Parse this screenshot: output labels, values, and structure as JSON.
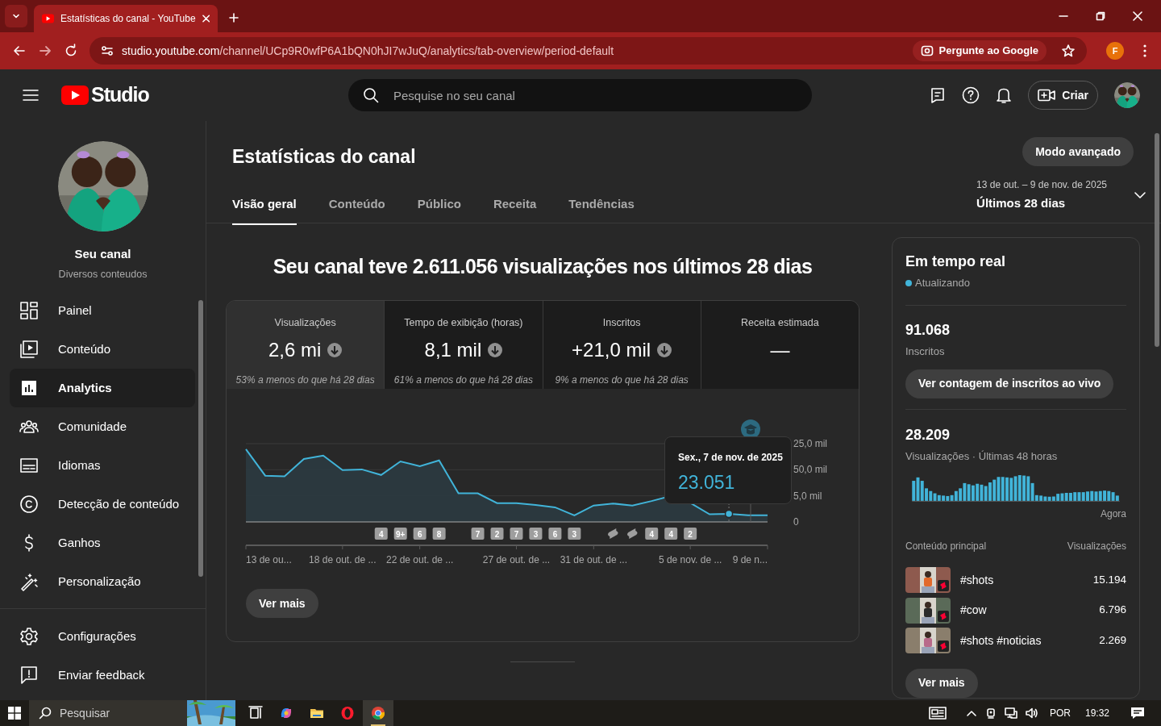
{
  "browser": {
    "tab_title": "Estatísticas do canal - YouTube",
    "url_host": "studio.youtube.com",
    "url_path": "/channel/UCp9R0wfP6A1bQN0hJI7wJuQ/analytics/tab-overview/period-default",
    "ask_google": "Pergunte ao Google",
    "profile_initial": "F"
  },
  "header": {
    "logo_text": "Studio",
    "search_placeholder": "Pesquise no seu canal",
    "create_label": "Criar"
  },
  "sidebar": {
    "channel_name": "Seu canal",
    "channel_description": "Diversos conteudos",
    "items": [
      {
        "kind": "dashboard",
        "label": "Painel",
        "selected": false
      },
      {
        "kind": "content",
        "label": "Conteúdo",
        "selected": false
      },
      {
        "kind": "analytics",
        "label": "Analytics",
        "selected": true
      },
      {
        "kind": "community",
        "label": "Comunidade",
        "selected": false
      },
      {
        "kind": "languages",
        "label": "Idiomas",
        "selected": false
      },
      {
        "kind": "copyright",
        "label": "Detecção de conteúdo",
        "selected": false
      },
      {
        "kind": "earnings",
        "label": "Ganhos",
        "selected": false
      },
      {
        "kind": "customization",
        "label": "Personalização",
        "selected": false
      }
    ],
    "footer_items": [
      {
        "kind": "settings",
        "label": "Configurações"
      },
      {
        "kind": "feedback",
        "label": "Enviar feedback"
      }
    ]
  },
  "page": {
    "title": "Estatísticas do canal",
    "advanced_button": "Modo avançado",
    "tabs": [
      {
        "label": "Visão geral",
        "selected": true
      },
      {
        "label": "Conteúdo",
        "selected": false
      },
      {
        "label": "Público",
        "selected": false
      },
      {
        "label": "Receita",
        "selected": false
      },
      {
        "label": "Tendências",
        "selected": false
      }
    ],
    "period": {
      "range": "13 de out. – 9 de nov. de 2025",
      "label": "Últimos 28 dias"
    }
  },
  "headline": "Seu canal teve 2.611.056 visualizações nos últimos 28 dias",
  "metrics": [
    {
      "label": "Visualizações",
      "value": "2,6 mi",
      "declined": true,
      "comparison": "53% a menos do que há 28 dias",
      "selected": true
    },
    {
      "label": "Tempo de exibição (horas)",
      "value": "8,1 mil",
      "declined": true,
      "comparison": "61% a menos do que há 28 dias",
      "selected": false
    },
    {
      "label": "Inscritos",
      "value": "+21,0 mil",
      "declined": true,
      "comparison": "9% a menos do que há 28 dias",
      "selected": false
    },
    {
      "label": "Receita estimada",
      "value": "—",
      "declined": false,
      "selected": false
    }
  ],
  "chart": {
    "y_labels": [
      "25,0 mil",
      "50,0 mil",
      "5,0 mil",
      "0"
    ],
    "x_labels": [
      "13 de ou...",
      "18 de out. de ...",
      "22 de out. de ...",
      "27 de out. de ...",
      "31 de out. de ...",
      "5 de nov. de ...",
      "9 de n..."
    ],
    "markers": [
      {
        "kind": "count",
        "label": "4"
      },
      {
        "kind": "count",
        "label": "9+"
      },
      {
        "kind": "count",
        "label": "6"
      },
      {
        "kind": "count",
        "label": "8"
      },
      {
        "kind": "count",
        "label": "7"
      },
      {
        "kind": "count",
        "label": "2"
      },
      {
        "kind": "count",
        "label": "7"
      },
      {
        "kind": "count",
        "label": "3"
      },
      {
        "kind": "count",
        "label": "6"
      },
      {
        "kind": "count",
        "label": "3"
      },
      {
        "kind": "shorts"
      },
      {
        "kind": "shorts"
      },
      {
        "kind": "count",
        "label": "4"
      },
      {
        "kind": "count",
        "label": "4"
      },
      {
        "kind": "count",
        "label": "2"
      }
    ],
    "tooltip": {
      "date": "Sex., 7 de nov. de 2025",
      "value": "23.051"
    },
    "more_button": "Ver mais"
  },
  "realtime": {
    "title": "Em tempo real",
    "status": "Atualizando",
    "subscribers": "91.068",
    "subscribers_label": "Inscritos",
    "live_button": "Ver contagem de inscritos ao vivo",
    "views": "28.209",
    "views_label": "Visualizações · Últimas 48 horas",
    "now_label": "Agora",
    "content_header": "Conteúdo principal",
    "views_header": "Visualizações",
    "top_content": [
      {
        "title": "#shots",
        "views": "15.194"
      },
      {
        "title": "#cow",
        "views": "6.796"
      },
      {
        "title": "#shots #noticias",
        "views": "2.269"
      }
    ],
    "more_button": "Ver mais"
  },
  "taskbar": {
    "search": "Pesquisar",
    "language": "POR",
    "time": "19:32"
  }
}
